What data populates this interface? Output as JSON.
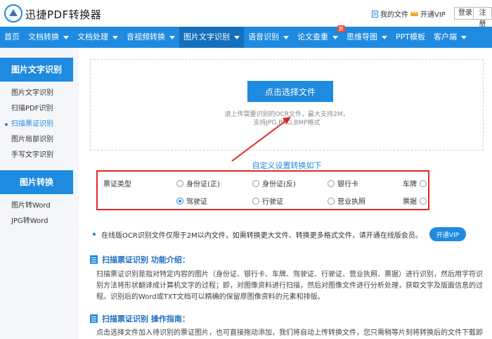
{
  "header": {
    "brand": "迅捷PDF转换器",
    "my_files": "我的文件",
    "open_vip": "开通VIP",
    "login": "登录",
    "register": "注册"
  },
  "nav": {
    "items": [
      {
        "label": "首页",
        "dropdown": false
      },
      {
        "label": "文档转换",
        "dropdown": true
      },
      {
        "label": "文档处理",
        "dropdown": true
      },
      {
        "label": "音视频转换",
        "dropdown": true
      },
      {
        "label": "图片文字识别",
        "dropdown": true,
        "active": true
      },
      {
        "label": "语音识别",
        "dropdown": true
      },
      {
        "label": "论文查重",
        "dropdown": true,
        "badge": "新"
      },
      {
        "label": "思维导图",
        "dropdown": true
      },
      {
        "label": "PPT模板",
        "dropdown": false
      },
      {
        "label": "客户端",
        "dropdown": true
      }
    ]
  },
  "sidebar": {
    "section1_title": "图片文字识别",
    "section1_items": [
      "图片文字识别",
      "扫描PDF识别",
      "扫描票证识别",
      "图片局部识别",
      "手写文字识别"
    ],
    "active_index": 2,
    "section2_title": "图片转换",
    "section2_items": [
      "图片转Word",
      "JPG转Word"
    ]
  },
  "upload": {
    "button": "点击选择文件",
    "hint_line1": "请上传需要识别的OCR文件，最大支持2M，",
    "hint_line2": "支持JPG,PNG,BMP格式"
  },
  "settings": {
    "title": "自定义设置转换如下",
    "type_label": "票证类型",
    "row1": [
      "身份证(正)",
      "身份证(反)",
      "银行卡",
      "车牌"
    ],
    "row2": [
      "驾驶证",
      "行驶证",
      "营业执照",
      "票据"
    ],
    "selected": "驾驶证"
  },
  "notice": {
    "text": "在线版OCR识别文件仅限于2M以内文件，如需转换更大文件、转换更多格式文件，请开通在线版会员。",
    "vip_button": "开通VIP"
  },
  "intro": {
    "title": "扫描票证识别 功能介绍：",
    "body": "扫描票证识别是指对特定内容的图片（身份证、银行卡、车牌、驾驶证、行驶证、营业执照、票据）进行识别，然后用字符识别方法将形状翻译成计算机文字的过程；即，对图像资料进行扫描，然后对图像文件进行分析处理，获取文字及版面信息的过程。识别后的Word或TXT文档可以精确的保留原图像资料的元素和排版。"
  },
  "guide": {
    "title": "扫描票证识别 操作指南：",
    "body": "点击选择文件加入待识别的票证图片，也可直接拖动添加，我们将自动上传转换文件，您只需稍等片刻将转换后的文件下载即可。"
  },
  "colors": {
    "primary": "#1e8ae0",
    "nav_active": "#146fbd",
    "highlight_border": "#e02828",
    "badge": "#f04a2e"
  }
}
